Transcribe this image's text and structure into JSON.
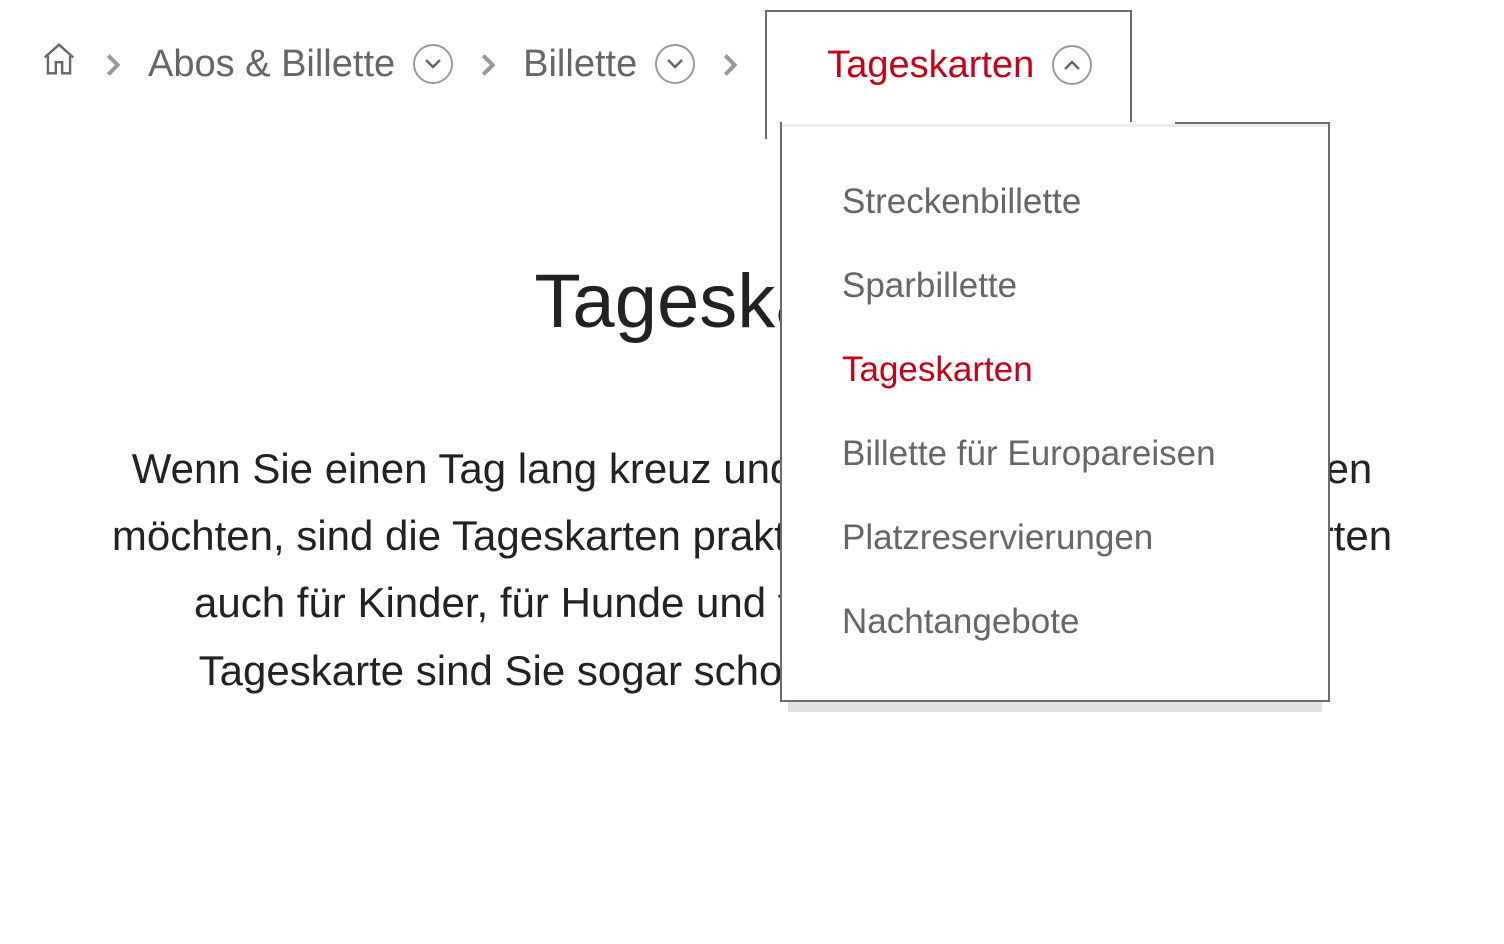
{
  "breadcrumb": {
    "items": [
      {
        "label": "Abos & Billette",
        "active": false
      },
      {
        "label": "Billette",
        "active": false
      },
      {
        "label": "Tageskarten",
        "active": true
      }
    ]
  },
  "dropdown": {
    "items": [
      {
        "label": "Streckenbillette",
        "active": false
      },
      {
        "label": "Sparbillette",
        "active": false
      },
      {
        "label": "Tageskarten",
        "active": true
      },
      {
        "label": "Billette für Europareisen",
        "active": false
      },
      {
        "label": "Platzreservierungen",
        "active": false
      },
      {
        "label": "Nachtangebote",
        "active": false
      }
    ]
  },
  "page": {
    "title": "Tageskarten.",
    "body": "Wenn Sie einen Tag lang kreuz und quer durch die Schweiz fahren möchten, sind die Tageskarten praktisch. Übrigens gibts Tageskarten auch für Kinder, für Hunde und für Velos. Tipp: Mit der Spar-Tageskarte sind Sie sogar schon ab 29 Franken unterwegs."
  },
  "colors": {
    "accent": "#c60018",
    "text_muted": "#666"
  }
}
